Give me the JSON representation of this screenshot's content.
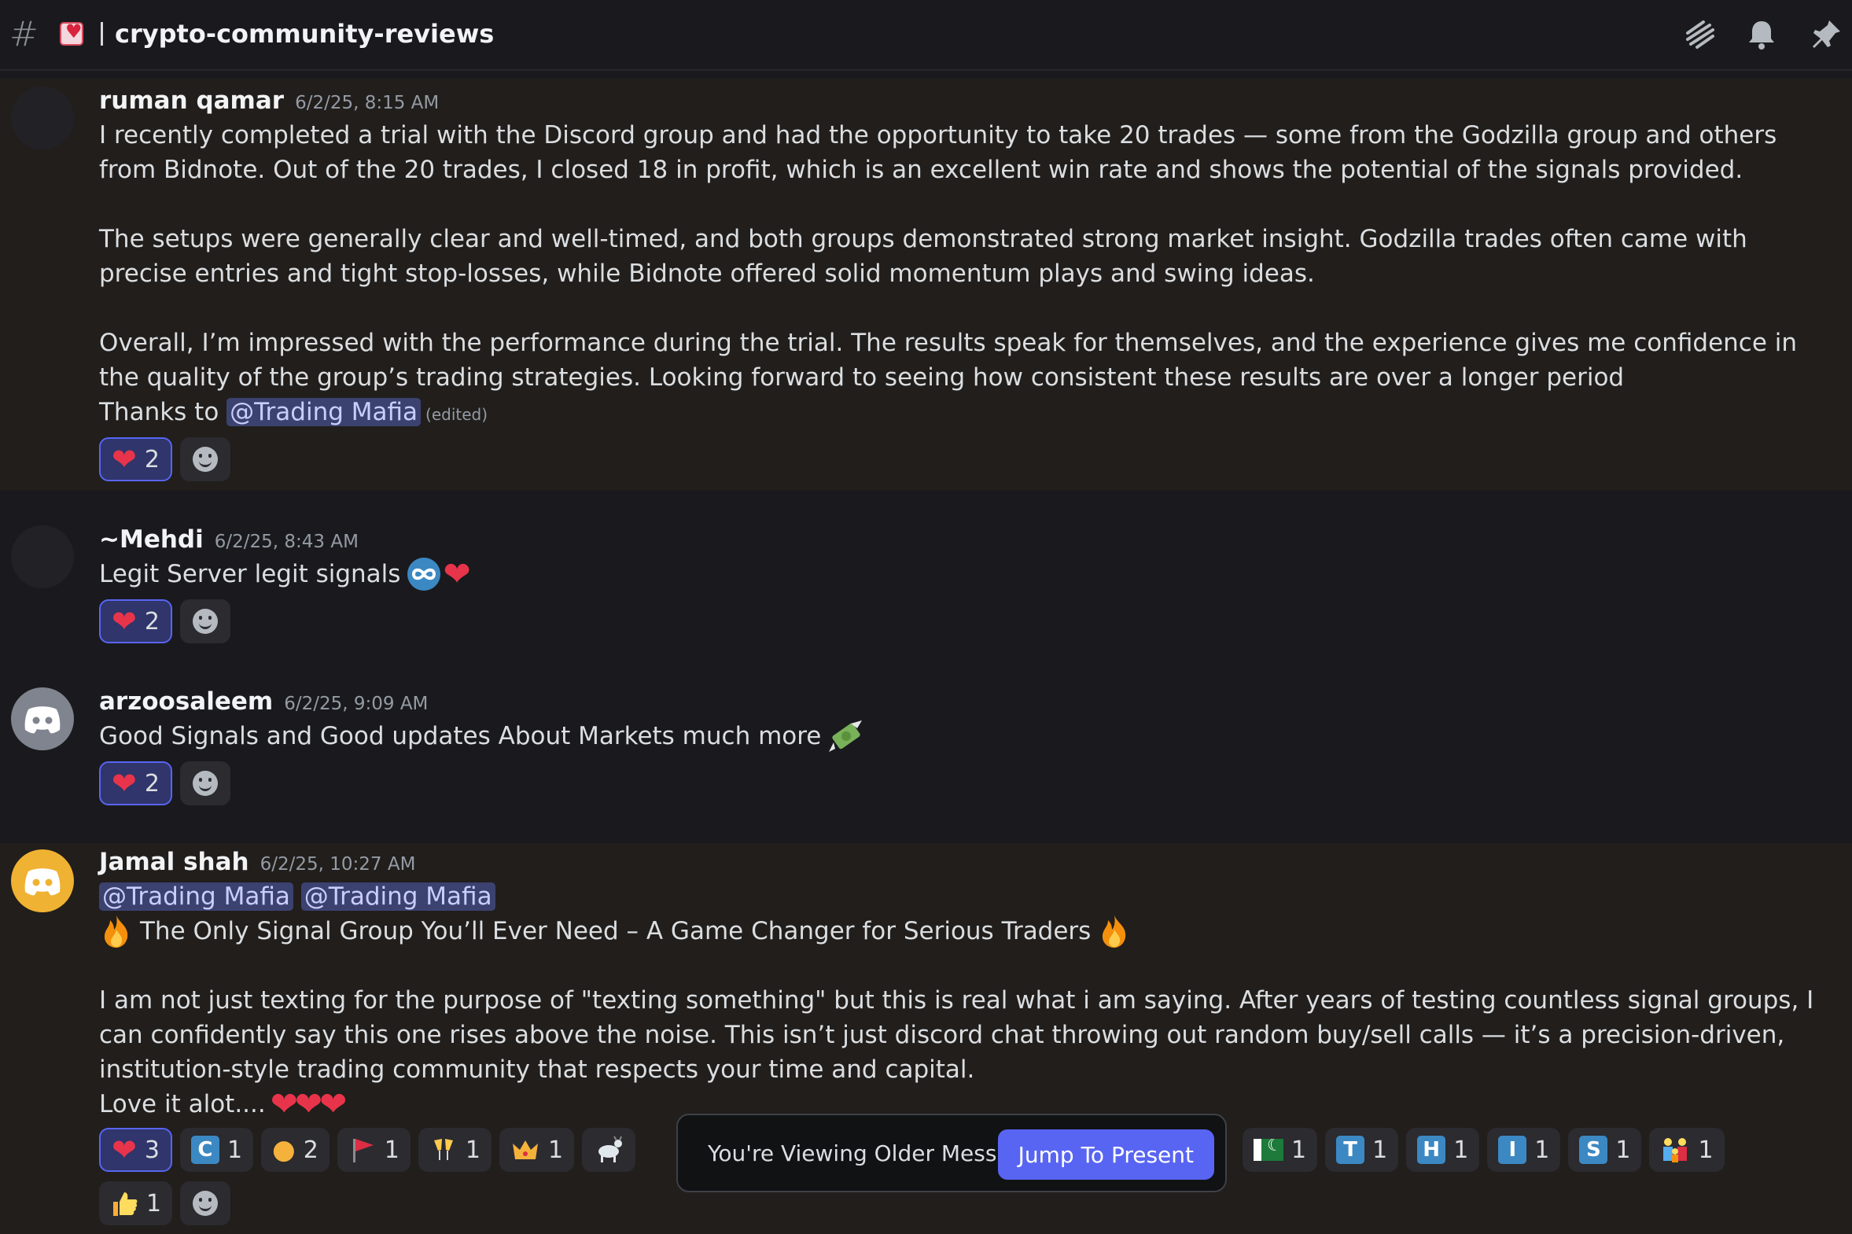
{
  "channel": {
    "hash": "#",
    "name": "crypto-community-reviews"
  },
  "header_icons": [
    "threads-icon",
    "bell-icon",
    "pin-icon"
  ],
  "messages": [
    {
      "author": "ruman qamar",
      "timestamp": "6/2/25, 8:15 AM",
      "p1": "I recently completed a trial with the Discord group and had the opportunity to take 20 trades — some from the Godzilla group and others from Bidnote. Out of the 20 trades, I closed 18 in profit, which is an excellent win rate and shows the potential of the signals provided.",
      "p2": "The setups were generally clear and well-timed, and both groups demonstrated strong market insight. Godzilla trades often came with precise entries and tight stop-losses, while Bidnote offered solid momentum plays and swing ideas.",
      "p3": "Overall, I’m impressed with the performance during the trial. The results speak for themselves, and the experience gives me confidence in the quality of the group’s trading strategies. Looking forward to seeing how consistent these results are over a longer period",
      "thanks": "Thanks to ",
      "mention": "@Trading Mafia",
      "edited": "(edited)",
      "reaction_count": "2"
    },
    {
      "author": "~Mehdi",
      "timestamp": "6/2/25, 8:43 AM",
      "text": "Legit Server legit signals",
      "reaction_count": "2"
    },
    {
      "author": "arzoosaleem",
      "timestamp": "6/2/25, 9:09 AM",
      "text": "Good Signals and Good updates About Markets much more",
      "reaction_count": "2"
    },
    {
      "author": "Jamal shah",
      "timestamp": "6/2/25, 10:27 AM",
      "mention1": "@Trading Mafia",
      "mention2": "@Trading Mafia",
      "headline": "The Only Signal Group You’ll Ever Need – A Game Changer for Serious Traders",
      "p1": "I am not just texting for the purpose of \"texting something\" but this is real what i am saying. After years of testing countless signal groups, I can confidently say this one rises above the noise. This isn’t just discord chat throwing out random buy/sell calls — it’s a precision-driven, institution-style trading community that respects your time and capital.",
      "p2": "Love it alot....",
      "reactions": [
        {
          "emoji": "heart",
          "count": "3"
        },
        {
          "emoji": "letter-c",
          "label": "C",
          "count": "1"
        },
        {
          "emoji": "money-bag",
          "count": "2"
        },
        {
          "emoji": "red-flag",
          "count": "1"
        },
        {
          "emoji": "clinking-glasses",
          "count": "1"
        },
        {
          "emoji": "crown",
          "count": "1"
        },
        {
          "emoji": "goat",
          "count": ""
        },
        {
          "emoji": "pakistan-flag",
          "count": "1"
        },
        {
          "emoji": "letter-t",
          "label": "T",
          "count": "1"
        },
        {
          "emoji": "letter-h",
          "label": "H",
          "count": "1"
        },
        {
          "emoji": "letter-i",
          "label": "I",
          "count": "1"
        },
        {
          "emoji": "letter-s",
          "label": "S",
          "count": "1"
        },
        {
          "emoji": "family",
          "count": "1"
        },
        {
          "emoji": "thumbs-up",
          "count": "1"
        }
      ]
    }
  ],
  "older_banner": {
    "text": "You're Viewing Older Messages",
    "button": "Jump To Present"
  }
}
